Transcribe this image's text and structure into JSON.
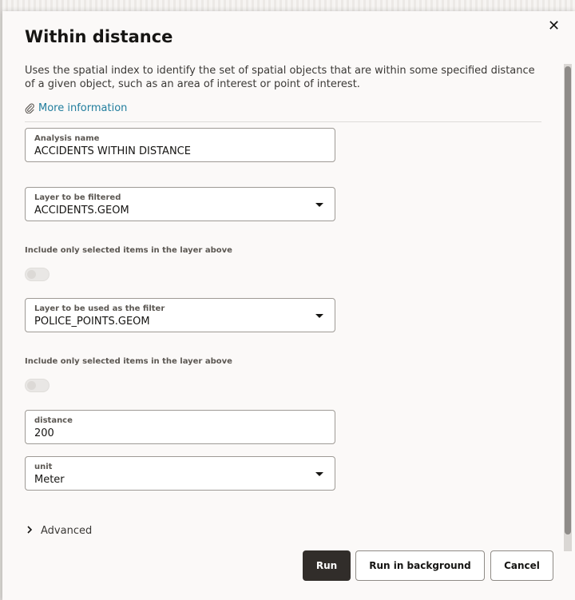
{
  "dialog": {
    "title": "Within distance",
    "close_symbol": "✕",
    "description": "Uses the spatial index to identify the set of spatial objects that are within some specified distance of a given object, such as an area of interest or point of interest.",
    "more_info_label": "More information",
    "more_info_icon": "paperclip-icon"
  },
  "form": {
    "analysis_name": {
      "label": "Analysis name",
      "value": "ACCIDENTS WITHIN DISTANCE"
    },
    "layer_filtered": {
      "label": "Layer to be filtered",
      "value": "ACCIDENTS.GEOM"
    },
    "include_selected_1": {
      "label": "Include only selected items in the layer above",
      "on": false
    },
    "layer_filter": {
      "label": "Layer to be used as the filter",
      "value": "POLICE_POINTS.GEOM"
    },
    "include_selected_2": {
      "label": "Include only selected items in the layer above",
      "on": false
    },
    "distance": {
      "label": "distance",
      "value": "200"
    },
    "unit": {
      "label": "unit",
      "value": "Meter"
    },
    "advanced_label": "Advanced"
  },
  "buttons": {
    "run": "Run",
    "run_background": "Run in background",
    "cancel": "Cancel"
  },
  "colors": {
    "primary_button": "#312d2a",
    "link": "#227e9e"
  }
}
